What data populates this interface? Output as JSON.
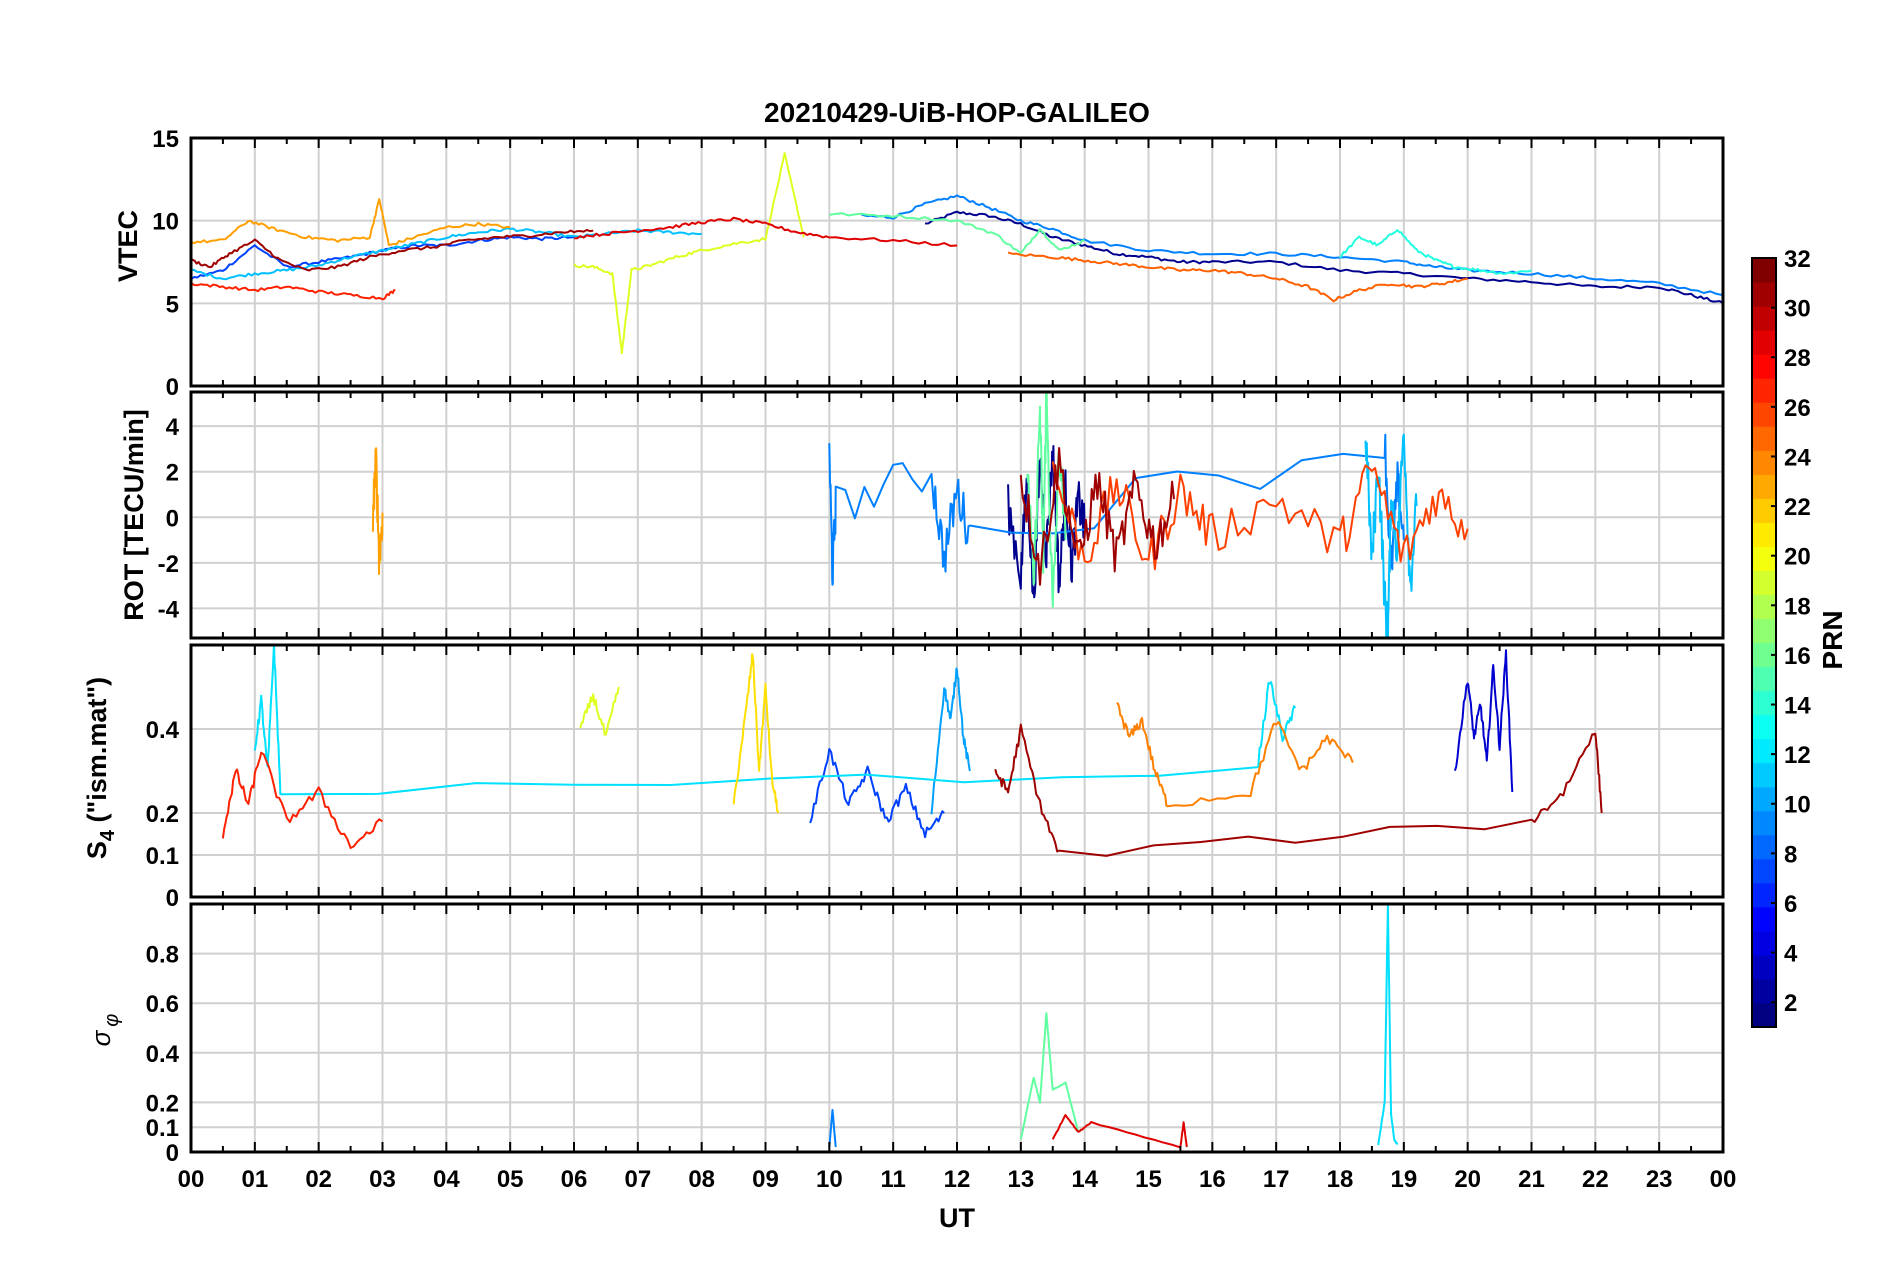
{
  "chart_data": {
    "type": "line",
    "title": "20210429-UiB-HOP-GALILEO",
    "xlabel": "UT",
    "x_tick_labels": [
      "00",
      "01",
      "02",
      "03",
      "04",
      "05",
      "06",
      "07",
      "08",
      "09",
      "10",
      "11",
      "12",
      "13",
      "14",
      "15",
      "16",
      "17",
      "18",
      "19",
      "20",
      "21",
      "22",
      "23",
      "00"
    ],
    "xlim": [
      0,
      24
    ],
    "grid": true,
    "colormap": "jet",
    "colorbar": {
      "label": "PRN",
      "range": [
        1,
        32
      ],
      "ticks": [
        "2",
        "4",
        "6",
        "8",
        "10",
        "12",
        "14",
        "16",
        "18",
        "20",
        "22",
        "24",
        "26",
        "28",
        "30",
        "32"
      ],
      "position": "right"
    },
    "panels": [
      {
        "name": "vtec",
        "ylabel": "VTEC",
        "ylim": [
          0,
          15
        ],
        "ytick_labels": [
          "0",
          "5",
          "10",
          "15"
        ],
        "series": [
          {
            "prn": 1,
            "color": "#00008f",
            "x": [
              11.5,
              12.0,
              12.5,
              13.0,
              13.5,
              14.0,
              14.5,
              15.0,
              15.5,
              16.0,
              17.0,
              18.0,
              19.0,
              20.0,
              21.0,
              22.0,
              23.0,
              23.5,
              24.0
            ],
            "y": [
              9.8,
              10.5,
              10.3,
              9.8,
              9.0,
              8.5,
              8.0,
              7.8,
              7.5,
              7.5,
              7.5,
              7.0,
              6.8,
              6.5,
              6.3,
              6.0,
              6.0,
              5.5,
              5.0
            ]
          },
          {
            "prn": 4,
            "color": "#0040ff",
            "x": [
              0,
              0.5,
              1.0,
              1.5,
              2.0,
              2.5,
              3.0,
              3.5,
              4.0,
              4.5,
              5.0,
              5.5,
              6.0
            ],
            "y": [
              6.5,
              7.0,
              8.5,
              7.2,
              7.5,
              7.8,
              8.2,
              8.5,
              8.5,
              8.8,
              9.0,
              8.9,
              9.0
            ]
          },
          {
            "prn": 6,
            "color": "#0080ff",
            "x": [
              10.5,
              11.0,
              11.5,
              12.0,
              12.5,
              13.0,
              13.5,
              14.0,
              15.0,
              16.0,
              17.0,
              18.0,
              19.0,
              19.5,
              20.0,
              21.0,
              22.0,
              23.0,
              24.0
            ],
            "y": [
              10.3,
              10.2,
              11.0,
              11.5,
              10.8,
              10.0,
              9.5,
              8.8,
              8.2,
              8.0,
              8.0,
              7.8,
              7.5,
              7.2,
              7.0,
              6.8,
              6.5,
              6.2,
              5.5
            ]
          },
          {
            "prn": 11,
            "color": "#00c0ff",
            "x": [
              0,
              0.5,
              1.0,
              1.5,
              2.0,
              2.5,
              3.0,
              3.5,
              4.0,
              4.5,
              5.0,
              5.5,
              6.0,
              6.5,
              7.0,
              7.5,
              8.0
            ],
            "y": [
              7.0,
              6.5,
              6.8,
              7.0,
              7.3,
              7.8,
              8.2,
              8.6,
              9.0,
              9.3,
              9.5,
              9.3,
              9.0,
              9.2,
              9.4,
              9.3,
              9.2
            ]
          },
          {
            "prn": 13,
            "color": "#20ffdf",
            "x": [
              18.0,
              18.3,
              18.6,
              18.9,
              19.2,
              19.5,
              19.8,
              20.2,
              20.6,
              21.0
            ],
            "y": [
              7.8,
              9.0,
              8.5,
              9.5,
              8.2,
              7.6,
              7.2,
              7.0,
              6.8,
              7.0
            ]
          },
          {
            "prn": 15,
            "color": "#60ff9f",
            "x": [
              10.0,
              11.0,
              12.0,
              12.6,
              13.0,
              13.3,
              13.6,
              14.0
            ],
            "y": [
              10.4,
              10.3,
              10.0,
              9.2,
              8.0,
              9.5,
              8.2,
              8.8
            ]
          },
          {
            "prn": 19,
            "color": "#dfff20",
            "x": [
              6.0,
              6.3,
              6.6,
              6.75,
              6.9,
              7.2,
              7.6,
              8.0,
              8.5,
              9.0,
              9.3,
              9.6
            ],
            "y": [
              7.3,
              7.2,
              6.8,
              2.0,
              7.0,
              7.3,
              7.8,
              8.2,
              8.6,
              8.9,
              14.0,
              9.0
            ]
          },
          {
            "prn": 23,
            "color": "#ff9f00",
            "x": [
              0,
              0.5,
              0.9,
              1.3,
              1.8,
              2.3,
              2.8,
              2.95,
              3.1,
              3.5,
              4.0,
              4.5,
              5.0
            ],
            "y": [
              8.7,
              8.8,
              10.0,
              9.5,
              9.0,
              8.8,
              9.0,
              11.3,
              8.5,
              9.0,
              9.6,
              9.8,
              9.6
            ]
          },
          {
            "prn": 25,
            "color": "#ff6000",
            "x": [
              12.8,
              13.5,
              14.0,
              14.5,
              15.0,
              15.5,
              16.0,
              16.5,
              17.0,
              17.5,
              17.9,
              18.3,
              18.8,
              19.2,
              19.6,
              20.0
            ],
            "y": [
              8.0,
              7.8,
              7.6,
              7.4,
              7.2,
              7.0,
              7.0,
              6.8,
              6.5,
              6.0,
              5.2,
              5.8,
              6.2,
              6.0,
              6.2,
              6.5
            ]
          },
          {
            "prn": 28,
            "color": "#ff2000",
            "x": [
              0,
              0.5,
              1.0,
              1.5,
              2.0,
              2.5,
              3.0,
              3.2
            ],
            "y": [
              6.2,
              6.0,
              5.8,
              6.0,
              5.7,
              5.5,
              5.3,
              5.8
            ]
          },
          {
            "prn": 29,
            "color": "#df0000",
            "x": [
              6.0,
              6.5,
              7.0,
              7.5,
              8.0,
              8.5,
              9.0,
              9.5,
              10.0,
              11.0,
              12.0
            ],
            "y": [
              9.0,
              9.2,
              9.4,
              9.6,
              9.9,
              10.1,
              9.8,
              9.3,
              9.0,
              8.8,
              8.5
            ]
          },
          {
            "prn": 31,
            "color": "#9f0000",
            "x": [
              0,
              0.3,
              0.6,
              1.0,
              1.4,
              1.8,
              2.3,
              2.8,
              3.3,
              3.8,
              4.3,
              4.8,
              5.3,
              5.8,
              6.3
            ],
            "y": [
              7.6,
              7.2,
              8.0,
              8.8,
              7.6,
              7.0,
              7.2,
              7.8,
              8.2,
              8.4,
              8.8,
              9.0,
              9.1,
              9.3,
              9.4
            ]
          }
        ]
      },
      {
        "name": "rot",
        "ylabel": "ROT [TECU/min]",
        "ylim": [
          -5.3,
          5.5
        ],
        "ytick_labels": [
          "-4",
          "-2",
          "0",
          "2",
          "4"
        ],
        "series": [
          {
            "prn": 1,
            "color": "#00008f",
            "x": [
              12.8,
              13.0,
              13.1,
              13.2,
              13.3,
              13.4,
              13.5,
              13.6,
              13.7,
              13.8,
              13.9,
              14.0
            ],
            "y": [
              0.5,
              -2.5,
              1.8,
              -3.8,
              2.5,
              -1.5,
              3.0,
              -3.0,
              1.2,
              -2.2,
              0.8,
              -0.5
            ]
          },
          {
            "prn": 6,
            "color": "#0080ff",
            "x": [
              10.0,
              10.05,
              10.1,
              11.6,
              11.8,
              12.0,
              12.2,
              18.7,
              18.8,
              18.9,
              19.0
            ],
            "y": [
              3.0,
              -2.5,
              0.5,
              2.0,
              -1.8,
              1.2,
              -0.8,
              3.5,
              -2.5,
              1.5,
              -1.0
            ]
          },
          {
            "prn": 11,
            "color": "#00c0ff",
            "x": [
              18.4,
              18.5,
              18.6,
              18.7,
              18.75,
              18.8,
              18.9,
              19.0,
              19.1,
              19.2
            ],
            "y": [
              3.8,
              -2.0,
              2.5,
              -3.5,
              -5.3,
              1.0,
              -1.5,
              4.0,
              -3.0,
              0.5
            ]
          },
          {
            "prn": 15,
            "color": "#60ff9f",
            "x": [
              13.1,
              13.2,
              13.3,
              13.35,
              13.4,
              13.5,
              13.6,
              13.7
            ],
            "y": [
              2.5,
              -3.2,
              4.8,
              -2.0,
              5.5,
              -4.2,
              3.0,
              -1.0
            ]
          },
          {
            "prn": 23,
            "color": "#ff9f00",
            "x": [
              2.85,
              2.9,
              2.95,
              3.0
            ],
            "y": [
              0.3,
              2.5,
              -2.0,
              0.2
            ]
          },
          {
            "prn": 26,
            "color": "#ff4000",
            "x": [
              13.5,
              14.0,
              14.5,
              15.0,
              15.5,
              16.0,
              17.0,
              18.0,
              18.5,
              19.0,
              19.5,
              20.0
            ],
            "y": [
              2.0,
              -1.8,
              1.5,
              -2.0,
              1.2,
              -0.8,
              0.8,
              -1.2,
              2.2,
              -1.8,
              1.0,
              -0.5
            ]
          },
          {
            "prn": 31,
            "color": "#9f0000",
            "x": [
              13.0,
              13.3,
              13.6,
              13.9,
              14.2,
              14.5,
              14.8,
              15.1,
              15.4
            ],
            "y": [
              1.8,
              -2.2,
              2.5,
              -2.0,
              1.6,
              -1.8,
              1.4,
              -1.2,
              0.8
            ]
          }
        ]
      },
      {
        "name": "s4",
        "ylabel_main": "S",
        "ylabel_sub": "4",
        "ylabel_rest": " (\"ism.mat\")",
        "ylim": [
          0,
          0.6
        ],
        "ytick_labels": [
          "0",
          "0.1",
          "0.2",
          "0.4"
        ],
        "series": [
          {
            "prn": 2,
            "color": "#0000cf",
            "x": [
              19.8,
              20.0,
              20.1,
              20.2,
              20.3,
              20.4,
              20.5,
              20.6,
              20.7
            ],
            "y": [
              0.3,
              0.52,
              0.38,
              0.46,
              0.32,
              0.55,
              0.36,
              0.58,
              0.25
            ]
          },
          {
            "prn": 4,
            "color": "#0040ff",
            "x": [
              9.7,
              10.0,
              10.3,
              10.6,
              10.9,
              11.2,
              11.5,
              11.8
            ],
            "y": [
              0.18,
              0.35,
              0.22,
              0.3,
              0.18,
              0.26,
              0.15,
              0.2
            ]
          },
          {
            "prn": 9,
            "color": "#00a0ff",
            "x": [
              11.6,
              11.8,
              11.9,
              12.0,
              12.1,
              12.2
            ],
            "y": [
              0.2,
              0.5,
              0.42,
              0.55,
              0.38,
              0.3
            ]
          },
          {
            "prn": 12,
            "color": "#00e0ff",
            "x": [
              1.0,
              1.1,
              1.2,
              1.3,
              1.4,
              16.7,
              16.9,
              17.1,
              17.3
            ],
            "y": [
              0.35,
              0.47,
              0.3,
              0.6,
              0.25,
              0.3,
              0.52,
              0.38,
              0.45
            ]
          },
          {
            "prn": 20,
            "color": "#ffdf00",
            "x": [
              8.5,
              8.7,
              8.8,
              8.9,
              9.0,
              9.1,
              9.2
            ],
            "y": [
              0.22,
              0.45,
              0.58,
              0.3,
              0.5,
              0.28,
              0.2
            ]
          },
          {
            "prn": 18,
            "color": "#dfff20",
            "x": [
              6.1,
              6.3,
              6.5,
              6.7
            ],
            "y": [
              0.4,
              0.48,
              0.38,
              0.5
            ]
          },
          {
            "prn": 24,
            "color": "#ff8000",
            "x": [
              14.5,
              14.7,
              14.9,
              15.1,
              15.3,
              16.6,
              17.0,
              17.4,
              17.8,
              18.2
            ],
            "y": [
              0.46,
              0.38,
              0.42,
              0.3,
              0.22,
              0.25,
              0.42,
              0.3,
              0.38,
              0.32
            ]
          },
          {
            "prn": 27,
            "color": "#ff2000",
            "x": [
              0.5,
              0.7,
              0.9,
              1.1,
              1.5,
              2.0,
              2.5,
              3.0
            ],
            "y": [
              0.15,
              0.3,
              0.22,
              0.35,
              0.18,
              0.25,
              0.12,
              0.18
            ]
          },
          {
            "prn": 31,
            "color": "#9f0000",
            "x": [
              12.6,
              12.8,
              13.0,
              13.3,
              13.6,
              21.0,
              21.5,
              22.0,
              22.1
            ],
            "y": [
              0.3,
              0.25,
              0.4,
              0.22,
              0.1,
              0.18,
              0.25,
              0.4,
              0.2
            ]
          }
        ]
      },
      {
        "name": "sigma_phi",
        "ylabel_main": "σ",
        "ylabel_sub": "φ",
        "ylim": [
          0,
          1
        ],
        "ytick_labels": [
          "0",
          "0.1",
          "0.2",
          "0.4",
          "0.6",
          "0.8"
        ],
        "series": [
          {
            "prn": 12,
            "color": "#00e0ff",
            "x": [
              18.6,
              18.7,
              18.75,
              18.8,
              18.85,
              18.9
            ],
            "y": [
              0.03,
              0.2,
              1.0,
              0.15,
              0.05,
              0.03
            ]
          },
          {
            "prn": 15,
            "color": "#60ff9f",
            "x": [
              13.0,
              13.2,
              13.3,
              13.4,
              13.5,
              13.7,
              13.9
            ],
            "y": [
              0.05,
              0.3,
              0.2,
              0.56,
              0.25,
              0.28,
              0.08
            ]
          },
          {
            "prn": 6,
            "color": "#0080ff",
            "x": [
              10.0,
              10.05,
              10.1
            ],
            "y": [
              0.02,
              0.17,
              0.02
            ]
          },
          {
            "prn": 29,
            "color": "#df0000",
            "x": [
              13.5,
              13.7,
              13.9,
              14.1,
              15.5,
              15.55,
              15.6
            ],
            "y": [
              0.05,
              0.15,
              0.08,
              0.12,
              0.02,
              0.12,
              0.02
            ]
          }
        ]
      }
    ]
  }
}
